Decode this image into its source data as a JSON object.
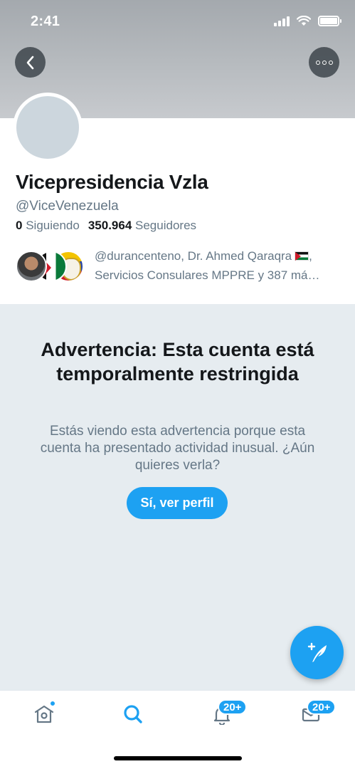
{
  "status_bar": {
    "time": "2:41"
  },
  "profile": {
    "name": "Vicepresidencia Vzla",
    "handle": "@ViceVenezuela",
    "following_count": "0",
    "following_label": "Siguiendo",
    "followers_count": "350.964",
    "followers_label": "Seguidores",
    "known_followers_line1": "@durancenteno, Dr. Ahmed Qaraqra",
    "known_followers_line1_end": ",",
    "known_followers_line2": "Servicios Consulares MPPRE y 387 má…"
  },
  "warning": {
    "title": "Advertencia: Esta cuenta está temporalmente restringida",
    "body": "Estás viendo esta advertencia porque esta cuenta ha presentado actividad inusual. ¿Aún quieres verla?",
    "button_label": "Sí, ver perfil"
  },
  "tab_bar": {
    "notifications_badge": "20+",
    "messages_badge": "20+"
  },
  "colors": {
    "accent": "#1da1f2",
    "text_primary": "#14171a",
    "text_secondary": "#657786",
    "warning_background": "#e6ecf0"
  },
  "icons": [
    "back-arrow-icon",
    "more-icon",
    "home-icon",
    "search-icon",
    "bell-icon",
    "mail-icon",
    "compose-tweet-icon"
  ]
}
